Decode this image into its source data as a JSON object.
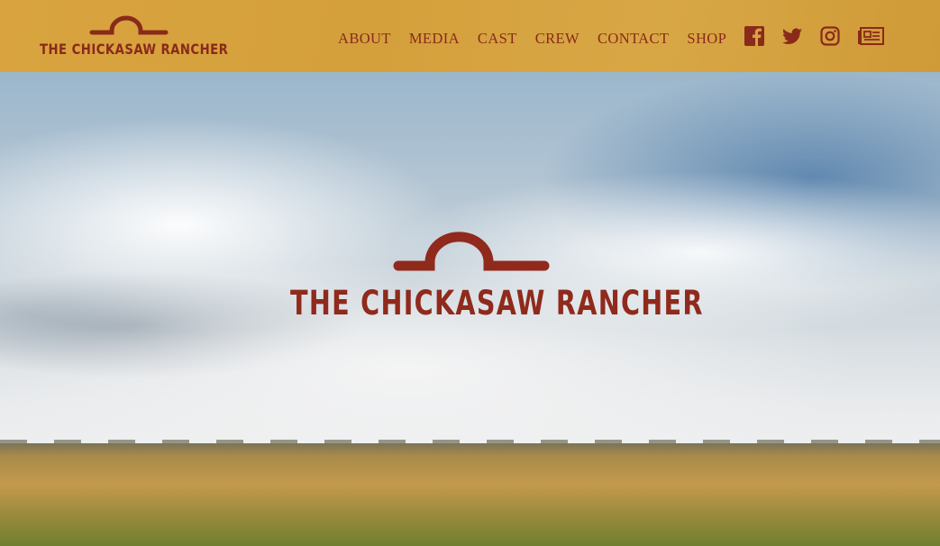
{
  "header": {
    "logo_text": "THE CHICKASAW RANCHER",
    "nav": [
      "ABOUT",
      "MEDIA",
      "CAST",
      "CREW",
      "CONTACT",
      "SHOP"
    ],
    "social": [
      "facebook-icon",
      "twitter-icon",
      "instagram-icon",
      "news-icon"
    ]
  },
  "hero": {
    "logo_text": "THE CHICKASAW RANCHER"
  },
  "colors": {
    "header_bg": "#d6a33f",
    "brand": "#8a2a1a"
  }
}
